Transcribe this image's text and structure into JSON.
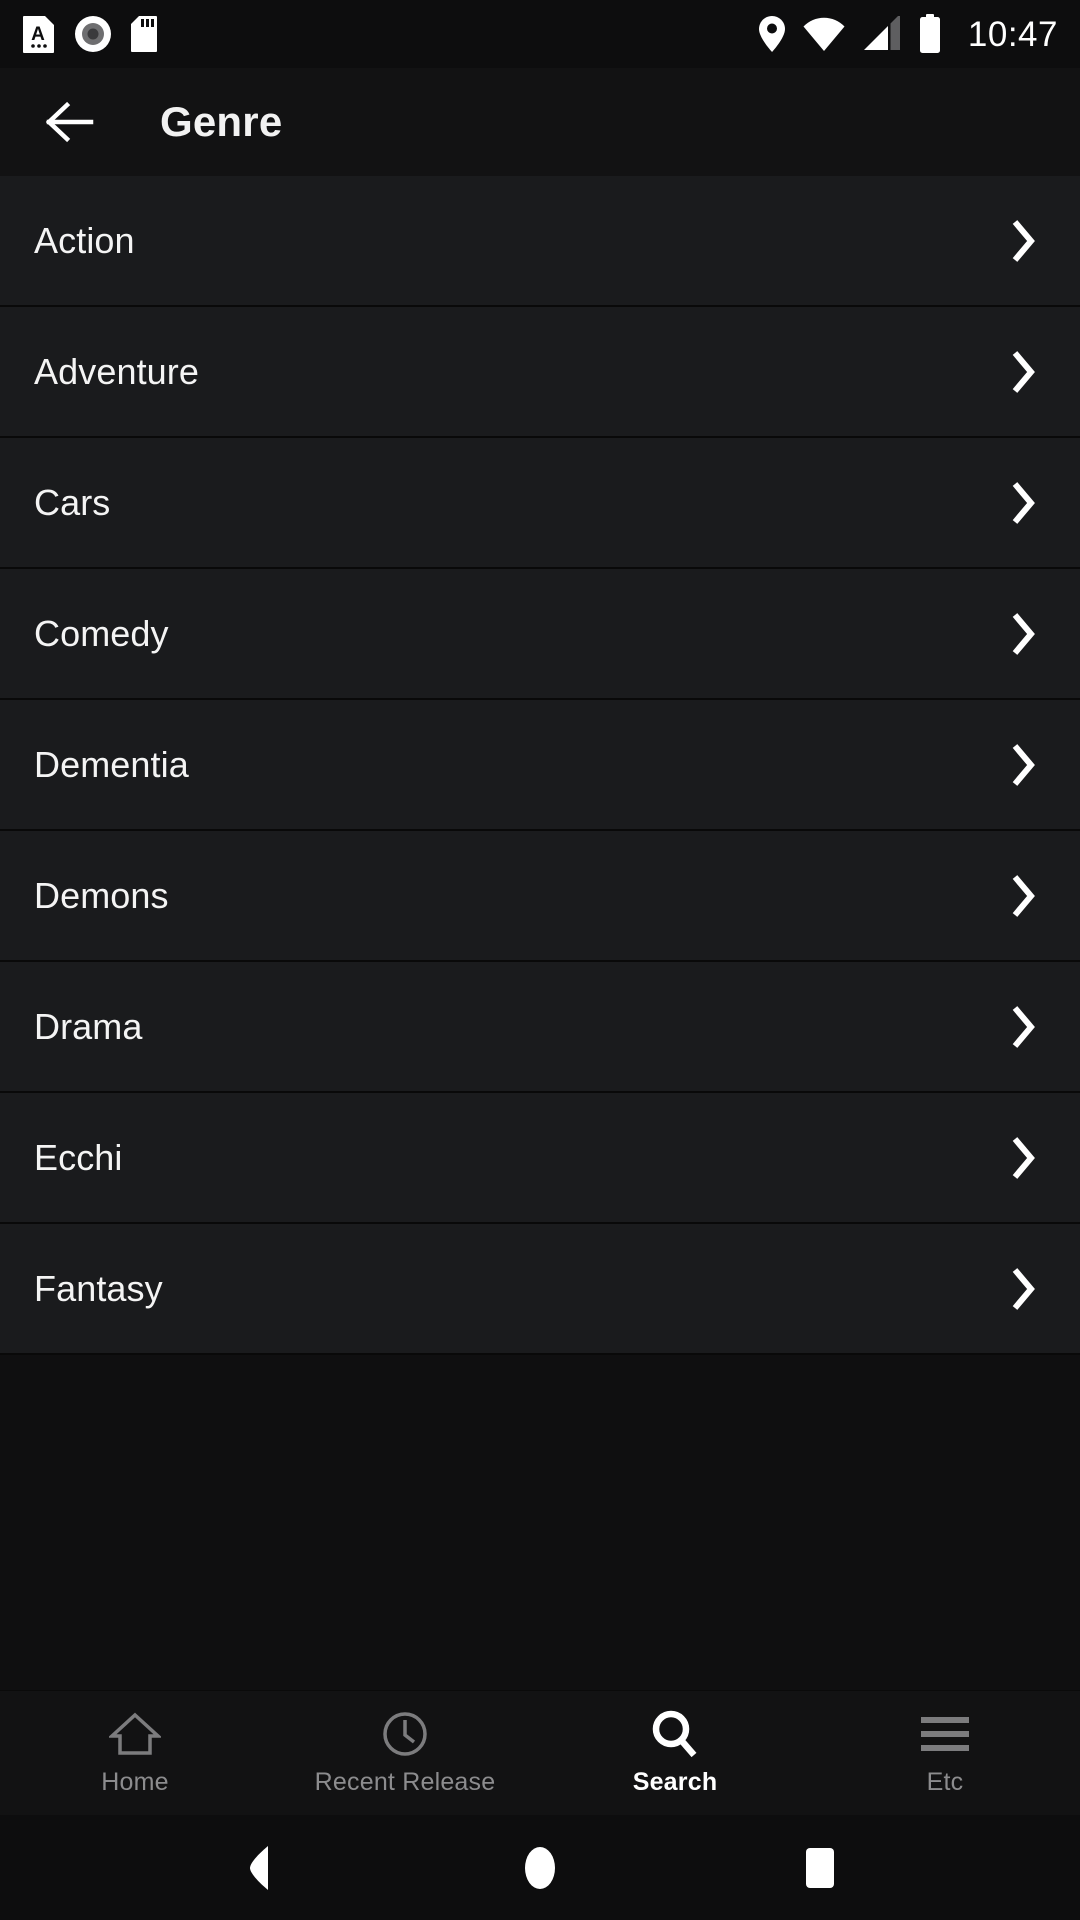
{
  "statusbar": {
    "time": "10:47",
    "left_icons": [
      {
        "name": "document-a-icon"
      },
      {
        "name": "record-disc-icon"
      },
      {
        "name": "sd-card-icon"
      }
    ],
    "right_icons": [
      {
        "name": "location-pin-icon"
      },
      {
        "name": "wifi-icon"
      },
      {
        "name": "cellular-signal-icon"
      },
      {
        "name": "battery-full-icon"
      }
    ]
  },
  "appbar": {
    "back_label": "Back",
    "title": "Genre"
  },
  "list": {
    "items": [
      {
        "label": "Action"
      },
      {
        "label": "Adventure"
      },
      {
        "label": "Cars"
      },
      {
        "label": "Comedy"
      },
      {
        "label": "Dementia"
      },
      {
        "label": "Demons"
      },
      {
        "label": "Drama"
      },
      {
        "label": "Ecchi"
      },
      {
        "label": "Fantasy"
      }
    ]
  },
  "tabbar": {
    "tabs": [
      {
        "label": "Home",
        "icon": "home-icon",
        "active": false
      },
      {
        "label": "Recent Release",
        "icon": "clock-icon",
        "active": false
      },
      {
        "label": "Search",
        "icon": "search-icon",
        "active": true
      },
      {
        "label": "Etc",
        "icon": "menu-icon",
        "active": false
      }
    ]
  },
  "sysnav": {
    "buttons": [
      {
        "name": "android-back-button"
      },
      {
        "name": "android-home-button"
      },
      {
        "name": "android-recents-button"
      }
    ]
  },
  "colors": {
    "background": "#0d0d0e",
    "row_background": "#1a1b1d",
    "appbar_background": "#121213",
    "text_primary": "#f4f4f4",
    "text_muted": "#8c8c8e",
    "accent": "#ffffff"
  }
}
